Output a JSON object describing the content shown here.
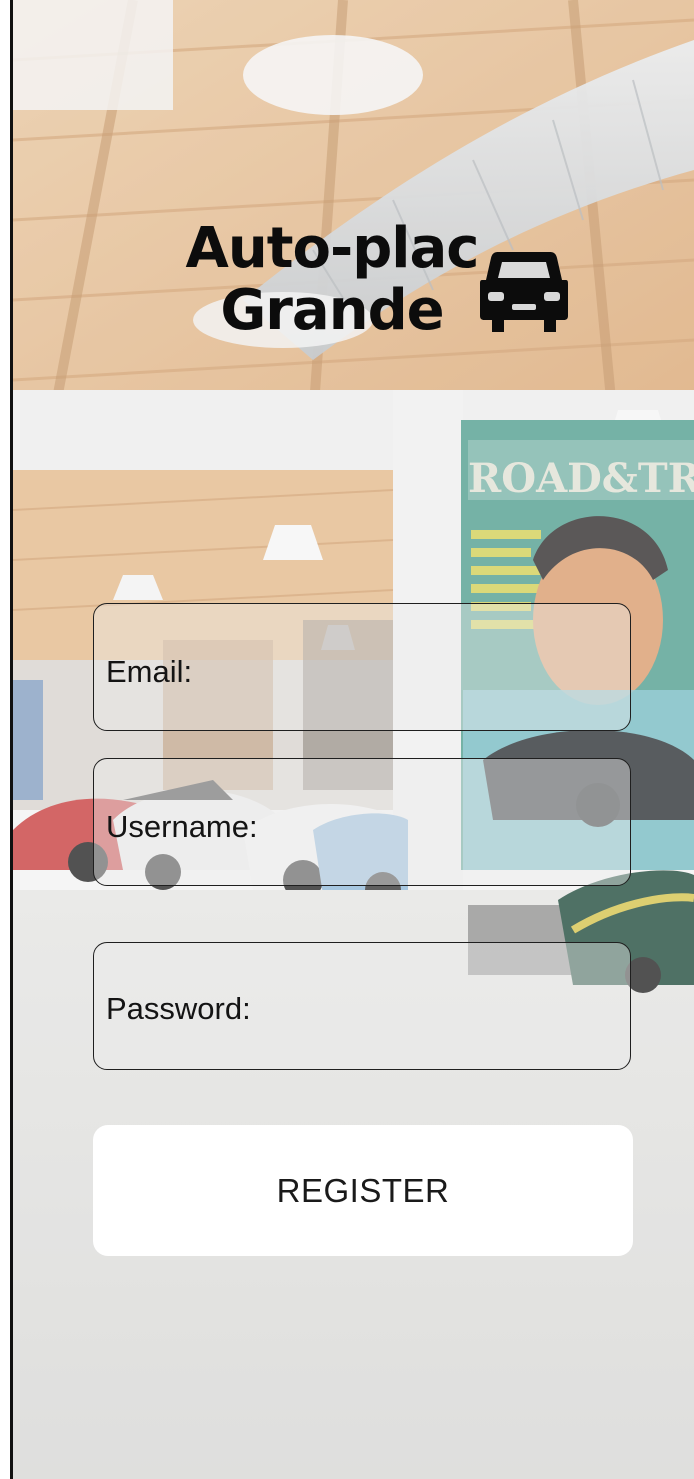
{
  "header": {
    "title_line1": "Auto-plac",
    "title_line2": "Grande",
    "icon": "car-icon"
  },
  "form": {
    "email_label": "Email:",
    "email_value": "",
    "username_label": "Username:",
    "username_value": "",
    "password_label": "Password:",
    "password_value": "",
    "submit_label": "REGISTER"
  },
  "colors": {
    "text": "#0c0c0c",
    "button_bg": "#ffffff",
    "field_border": "#1f1f1f"
  }
}
